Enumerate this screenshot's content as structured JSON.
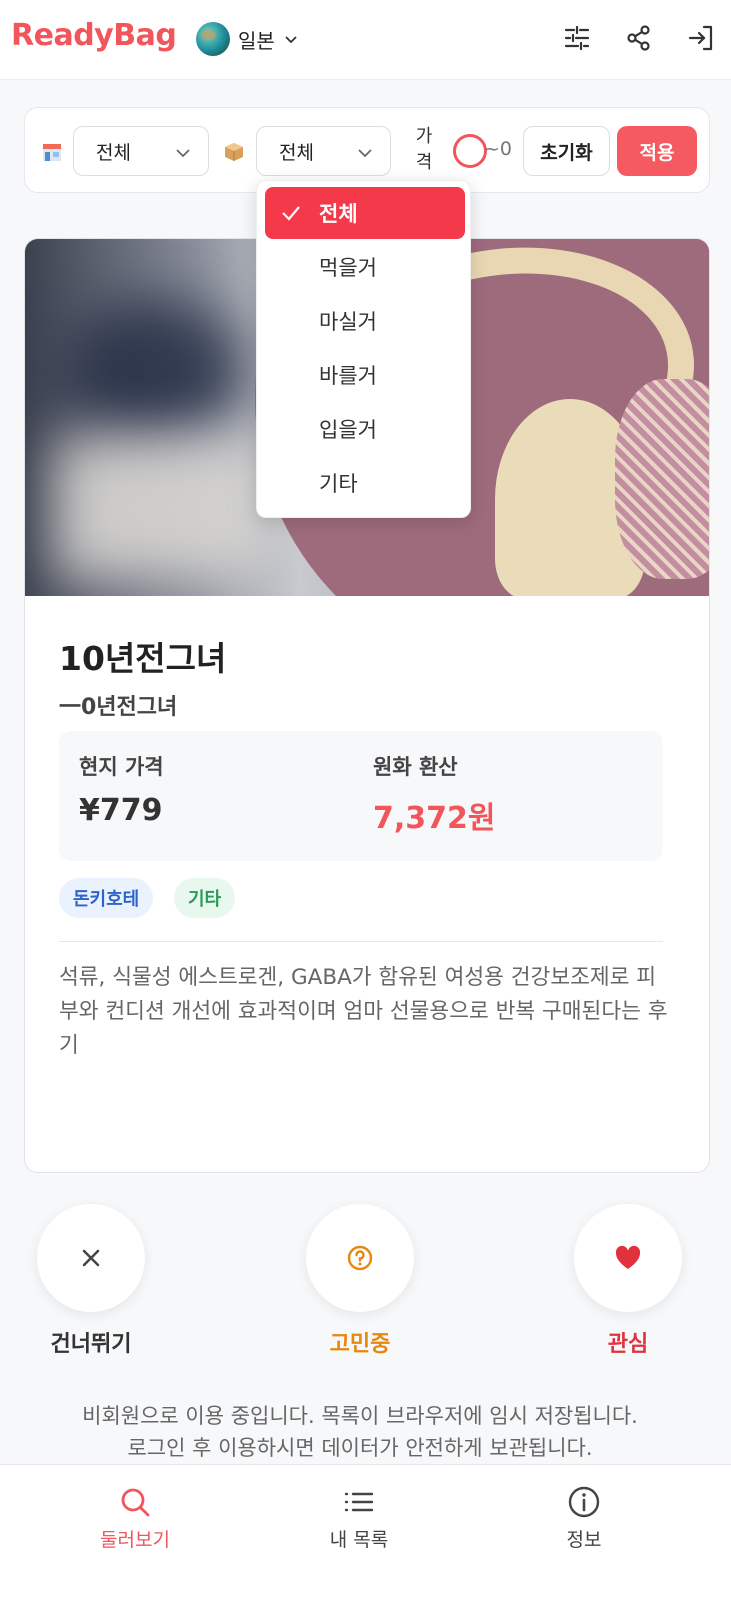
{
  "header": {
    "logo": "ReadyBag",
    "country": "일본"
  },
  "filters": {
    "store_value": "전체",
    "category_value": "전체",
    "price_label": "가격",
    "price_range": "~0",
    "reset_label": "초기화",
    "apply_label": "적용"
  },
  "dropdown": {
    "options": [
      "전체",
      "먹을거",
      "마실거",
      "바를거",
      "입을거",
      "기타"
    ],
    "selected_index": 0
  },
  "product": {
    "title": "10년전그녀",
    "subtitle": "一0년전그녀",
    "local_price_label": "현지 가격",
    "local_price": "¥779",
    "krw_label": "원화 환산",
    "krw_price": "7,372원",
    "tags": [
      "돈키호테",
      "기타"
    ],
    "description": "석류, 식물성 에스트로겐, GABA가 함유된 여성용 건강보조제로 피부와 컨디션 개선에 효과적이며 엄마 선물용으로 반복 구매된다는 후기"
  },
  "actions": {
    "skip": "건너뛰기",
    "thinking": "고민중",
    "interest": "관심"
  },
  "notice": {
    "line1": "비회원으로 이용 중입니다. 목록이 브라우저에 임시 저장됩니다.",
    "line2": "로그인 후 이용하시면 데이터가 안전하게 보관됩니다."
  },
  "nav": {
    "browse": "둘러보기",
    "my_list": "내 목록",
    "info": "정보"
  },
  "colors": {
    "brand": "#f2555a",
    "thinking": "#e8870e",
    "interest": "#e0313d"
  }
}
